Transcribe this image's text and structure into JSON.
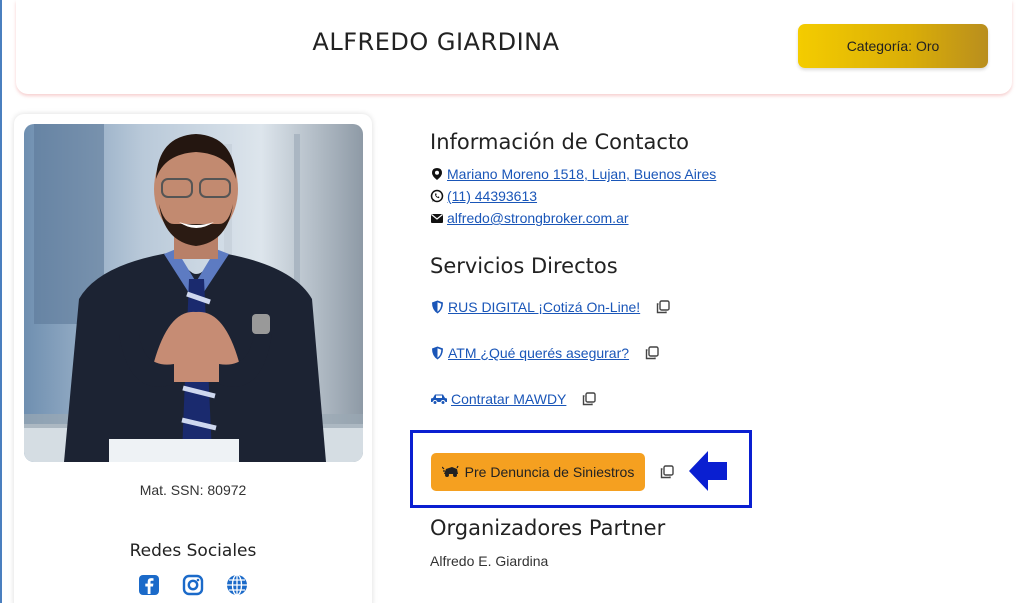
{
  "header": {
    "name": "ALFREDO GIARDINA",
    "category_label": "Categoría: Oro"
  },
  "profile": {
    "registration": "Mat. SSN: 80972",
    "social_title": "Redes Sociales",
    "social_icons": [
      "facebook-icon",
      "instagram-icon",
      "globe-icon"
    ]
  },
  "contact": {
    "title": "Información de Contacto",
    "address": "Mariano Moreno 1518, Lujan, Buenos Aires",
    "phone": "(11) 44393613",
    "email": "alfredo@strongbroker.com.ar"
  },
  "services": {
    "title": "Servicios Directos",
    "items": [
      {
        "label": " RUS DIGITAL ¡Cotizá On-Line! ",
        "icon": "shield-icon"
      },
      {
        "label": " ATM ¿Qué querés asegurar? ",
        "icon": "shield-icon"
      },
      {
        "label": " Contratar MAWDY ",
        "icon": "car-icon"
      }
    ],
    "claim_button": "Pre Denuncia de Siniestros"
  },
  "partners": {
    "title": "Organizadores Partner",
    "names": [
      "Alfredo E. Giardina"
    ]
  },
  "colors": {
    "gold": "#f4cc00",
    "orange": "#f5a020",
    "link": "#1a56b8",
    "highlight": "#0a1fd1"
  }
}
